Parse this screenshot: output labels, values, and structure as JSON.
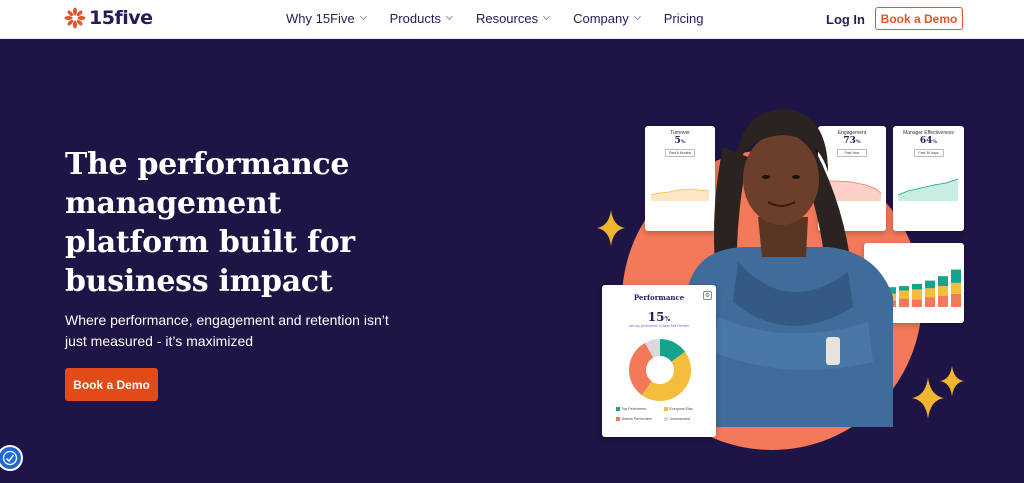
{
  "nav": {
    "logo_text": "15five",
    "links": [
      {
        "label": "Why 15Five",
        "has_dropdown": true
      },
      {
        "label": "Products",
        "has_dropdown": true
      },
      {
        "label": "Resources",
        "has_dropdown": true
      },
      {
        "label": "Company",
        "has_dropdown": true
      },
      {
        "label": "Pricing",
        "has_dropdown": false
      }
    ],
    "login_label": "Log In",
    "book_demo_label": "Book a Demo"
  },
  "hero": {
    "headline_lines": [
      "The performance",
      "management",
      "platform built for",
      "business impact"
    ],
    "subtext_lines": [
      "Where performance, engagement and retention isn’t",
      "just measured - it’s maximized"
    ],
    "cta_label": "Book a Demo"
  },
  "illustration": {
    "turnover_card": {
      "title": "Turnover",
      "value": "5",
      "unit": "%",
      "button": "Past 6 Months"
    },
    "engagement_card": {
      "title": "Engagement",
      "value": "73",
      "unit": "%",
      "button": "Past Year"
    },
    "manager_card": {
      "title": "Manager Effectiveness",
      "value": "64",
      "unit": "%",
      "button": "Past 30 days"
    },
    "performance_card": {
      "title": "Performance",
      "value": "15",
      "unit": "%",
      "subtitle": "are top performers in Best Self Review",
      "donut": [
        {
          "label": "Top Performers",
          "value": 15,
          "color": "#14a38b"
        },
        {
          "label": "Everyone Else",
          "value": 45,
          "color": "#f4bd3b"
        },
        {
          "label": "Bottom Performers",
          "value": 32,
          "color": "#f4795a"
        },
        {
          "label": "Unmeasured",
          "value": 8,
          "color": "#d8d8de"
        }
      ]
    },
    "bars_card": {
      "stacks": [
        [
          6,
          6,
          6
        ],
        [
          8,
          7,
          4
        ],
        [
          7,
          9,
          5
        ],
        [
          9,
          8,
          7
        ],
        [
          10,
          9,
          9
        ],
        [
          12,
          10,
          12
        ]
      ],
      "colors": [
        "#f4795a",
        "#f4bd3b",
        "#14a38b"
      ]
    }
  },
  "colors": {
    "background": "#1f1446",
    "accent": "#e24a17",
    "brand_dark": "#2a1a55",
    "sparkle": "#f2b52e"
  }
}
